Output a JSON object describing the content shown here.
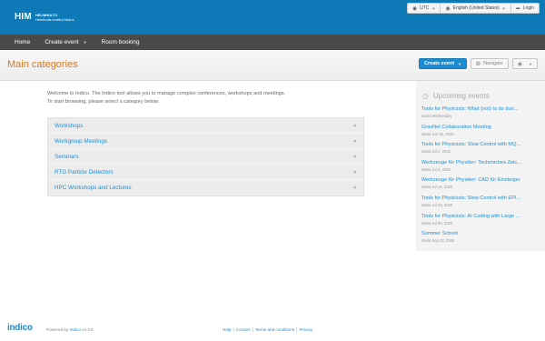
{
  "header": {
    "logo_mark": "HIM",
    "logo_line1": "HELMHOLTZ",
    "logo_line2": "Helmholtz-Institut Mainz",
    "timezone": "UTC",
    "language": "English (United States)",
    "login": "Login",
    "background": "#0d79b6"
  },
  "menu": {
    "home": "Home",
    "create_event": "Create event",
    "room_booking": "Room booking"
  },
  "titlebar": {
    "title": "Main categories",
    "create_event_button": "Create event",
    "navigate_button": "Navigate",
    "view_icon": "eye-icon"
  },
  "welcome": {
    "line1": "Welcome to Indico. The Indico tool allows you to manage complex conferences, workshops and meetings.",
    "line2": "To start browsing, please select a category below."
  },
  "categories": [
    {
      "label": "Workshops"
    },
    {
      "label": "Workgroup Meetings"
    },
    {
      "label": "Seminars"
    },
    {
      "label": "RTG Particle Detectors"
    },
    {
      "label": "HPC Workshops and Lectures"
    }
  ],
  "sidebar": {
    "title": "Upcoming events",
    "icon": "clock-icon",
    "events": [
      {
        "name": "Tools for Physicists: What (not) to do duri...",
        "date": "starts Wednesday"
      },
      {
        "name": "GravNet Collaboration Meeting",
        "date": "starts Jun 26, 2025"
      },
      {
        "name": "Tools for Physicists: Slow Control with MQ...",
        "date": "starts Jul 2, 2025"
      },
      {
        "name": "Werkzeuge für Physiker: Technisches Zeic...",
        "date": "starts Jul 9, 2025"
      },
      {
        "name": "Werkzeuge für Physiker: CAD für Einsteiger",
        "date": "starts Jul 16, 2025"
      },
      {
        "name": "Tools for Physicists: Slow Control with EPI...",
        "date": "starts Jul 23, 2025"
      },
      {
        "name": "Tools for Physicists: AI Coding with Large ...",
        "date": "starts Jul 30, 2025"
      },
      {
        "name": "Summer School",
        "date": "starts Sep 22, 2025"
      }
    ]
  },
  "footer": {
    "logo": "indico",
    "powered_prefix": "Powered by",
    "powered_link": "Indico",
    "version": "v3.3.5",
    "help": "Help",
    "contact": "Contact",
    "terms": "Terms and conditions",
    "privacy": "Privacy",
    "separator": "|"
  }
}
